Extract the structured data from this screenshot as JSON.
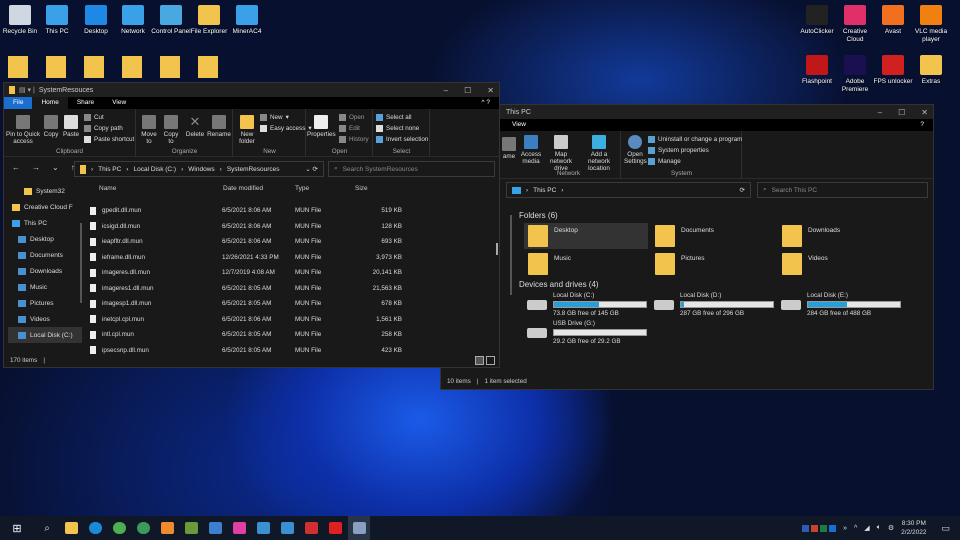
{
  "desktop": {
    "left_icons": [
      {
        "label": "Recycle Bin",
        "color": "#cfd8e0"
      },
      {
        "label": "This PC",
        "color": "#3aa0e8"
      },
      {
        "label": "Desktop",
        "color": "#1e88e5"
      },
      {
        "label": "Network",
        "color": "#3aa0e8"
      },
      {
        "label": "Control Panel",
        "color": "#4aa8e0"
      },
      {
        "label": "File Explorer",
        "color": "#f2c44d"
      },
      {
        "label": "MinerAC4",
        "color": "#3aa0e8"
      }
    ],
    "right_icons": [
      {
        "label": "AutoClicker",
        "color": "#222"
      },
      {
        "label": "Creative Cloud",
        "color": "#e0306a"
      },
      {
        "label": "Avast",
        "color": "#f07020"
      },
      {
        "label": "VLC media player",
        "color": "#f08010"
      },
      {
        "label": "Flashpoint",
        "color": "#c01818"
      },
      {
        "label": "Adobe Premiere",
        "color": "#1a1050"
      },
      {
        "label": "FPS unlocker",
        "color": "#d02020"
      },
      {
        "label": "Extras",
        "color": "#f2c44d"
      }
    ]
  },
  "left_window": {
    "title": "SystemResouces",
    "tabs": [
      "File",
      "Home",
      "Share",
      "View"
    ],
    "ribbon": {
      "pin": "Pin to Quick access",
      "copy": "Copy",
      "paste": "Paste",
      "cut": "Cut",
      "copy_path": "Copy path",
      "paste_shortcut": "Paste shortcut",
      "clipboard": "Clipboard",
      "move_to": "Move to",
      "copy_to": "Copy to",
      "delete": "Delete",
      "rename": "Rename",
      "organize": "Organize",
      "new_folder": "New folder",
      "new_item": "New",
      "easy_access": "Easy access",
      "new": "New",
      "properties": "Properties",
      "open": "Open",
      "edit": "Edit",
      "history": "History",
      "open_group": "Open",
      "select_all": "Select all",
      "select_none": "Select none",
      "invert_selection": "Invert selection",
      "select": "Select"
    },
    "address": {
      "crumbs": [
        "This PC",
        "Local Disk (C:)",
        "Windows",
        "SystemResources"
      ],
      "search_placeholder": "Search SystemResources"
    },
    "nav": [
      "System32",
      "Creative Cloud F",
      "This PC",
      "Desktop",
      "Documents",
      "Downloads",
      "Music",
      "Pictures",
      "Videos",
      "Local Disk (C:)"
    ],
    "columns": [
      "Name",
      "Date modified",
      "Type",
      "Size"
    ],
    "files": [
      [
        "gpedit.dll.mun",
        "6/5/2021 8:06 AM",
        "MUN File",
        "519 KB"
      ],
      [
        "icsigd.dll.mun",
        "6/5/2021 8:06 AM",
        "MUN File",
        "128 KB"
      ],
      [
        "ieapfltr.dll.mun",
        "6/5/2021 8:06 AM",
        "MUN File",
        "693 KB"
      ],
      [
        "ieframe.dll.mun",
        "12/26/2021 4:33 PM",
        "MUN File",
        "3,973 KB"
      ],
      [
        "imageres.dll.mun",
        "12/7/2019 4:08 AM",
        "MUN File",
        "20,141 KB"
      ],
      [
        "imageres1.dll.mun",
        "6/5/2021 8:05 AM",
        "MUN File",
        "21,563 KB"
      ],
      [
        "imagesp1.dll.mun",
        "6/5/2021 8:05 AM",
        "MUN File",
        "678 KB"
      ],
      [
        "inetcpl.cpl.mun",
        "6/5/2021 8:06 AM",
        "MUN File",
        "1,561 KB"
      ],
      [
        "intl.cpl.mun",
        "6/5/2021 8:05 AM",
        "MUN File",
        "258 KB"
      ],
      [
        "ipsecsnp.dll.mun",
        "6/5/2021 8:05 AM",
        "MUN File",
        "423 KB"
      ]
    ],
    "status": "170 items"
  },
  "right_window": {
    "title": "This PC",
    "tab": "View",
    "ribbon": {
      "rename_partial": "ame",
      "access_media": "Access media",
      "map_drive": "Map network drive",
      "add_location": "Add a network location",
      "network": "Network",
      "open_settings": "Open Settings",
      "uninstall": "Uninstall or change a program",
      "system_properties": "System properties",
      "manage": "Manage",
      "system": "System"
    },
    "address": {
      "crumb": "This PC",
      "search_placeholder": "Search This PC"
    },
    "folders_heading": "Folders (6)",
    "folders": [
      "Desktop",
      "Documents",
      "Downloads",
      "Music",
      "Pictures",
      "Videos"
    ],
    "drives_heading": "Devices and drives (4)",
    "drives": [
      {
        "name": "Local Disk (C:)",
        "free": "73.8 GB free of 145 GB",
        "used_fraction": 0.49
      },
      {
        "name": "Local Disk (D:)",
        "free": "287 GB free of 296 GB",
        "used_fraction": 0.03
      },
      {
        "name": "Local Disk (E:)",
        "free": "284 GB free of 488 GB",
        "used_fraction": 0.42
      },
      {
        "name": "USB Drive (G:)",
        "free": "29.2 GB free of 29.2 GB",
        "used_fraction": 0.0
      }
    ],
    "status": {
      "items": "10 items",
      "selected": "1 item selected"
    }
  },
  "taskbar": {
    "time": "8:30 PM",
    "date": "2/2/2022",
    "apps": [
      "file-explorer",
      "edge",
      "chrome",
      "chrome-beta",
      "media-player",
      "minecraft",
      "store",
      "itunes",
      "photos",
      "photos2",
      "roblox-studio",
      "roblox",
      "snipping-tool"
    ],
    "app_colors": [
      "#f2c44d",
      "#1a8ad8",
      "#4caf50",
      "#3c9a5a",
      "#f08a30",
      "#6a9a3a",
      "#3a80d0",
      "#e040a0",
      "#3a90d0",
      "#3a90d0",
      "#d03030",
      "#e02020",
      "#8aa0c0"
    ]
  }
}
